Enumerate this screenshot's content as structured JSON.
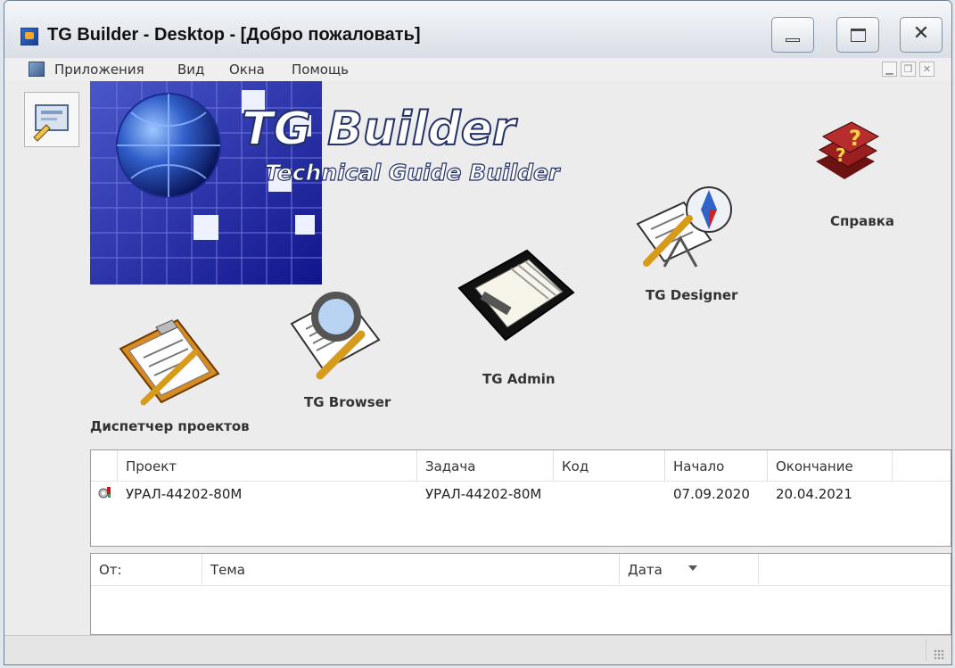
{
  "window": {
    "title": "TG Builder - Desktop - [Добро пожаловать]",
    "controls": [
      "minimize",
      "maximize",
      "close"
    ]
  },
  "menu": {
    "items": [
      "Приложения",
      "Вид",
      "Окна",
      "Помощь"
    ]
  },
  "hero": {
    "title": "TG Builder",
    "subtitle": "Technical Guide Builder"
  },
  "launchers": [
    {
      "label": "Справка",
      "icon": "help-books-icon"
    },
    {
      "label": "TG Designer",
      "icon": "designer-compass-icon"
    },
    {
      "label": "TG Admin",
      "icon": "admin-organizer-icon"
    },
    {
      "label": "TG Browser",
      "icon": "browser-magnifier-icon"
    },
    {
      "label": "Диспетчер проектов",
      "icon": "project-clipboard-icon"
    }
  ],
  "projects": {
    "columns": [
      "Проект",
      "Задача",
      "Код",
      "Начало",
      "Окончание"
    ],
    "rows": [
      {
        "project": "УРАЛ-44202-80М",
        "task": "УРАЛ-44202-80М",
        "code": "",
        "start": "07.09.2020",
        "end": "20.04.2021"
      }
    ]
  },
  "messages": {
    "columns": [
      "От:",
      "Тема",
      "Дата"
    ]
  }
}
